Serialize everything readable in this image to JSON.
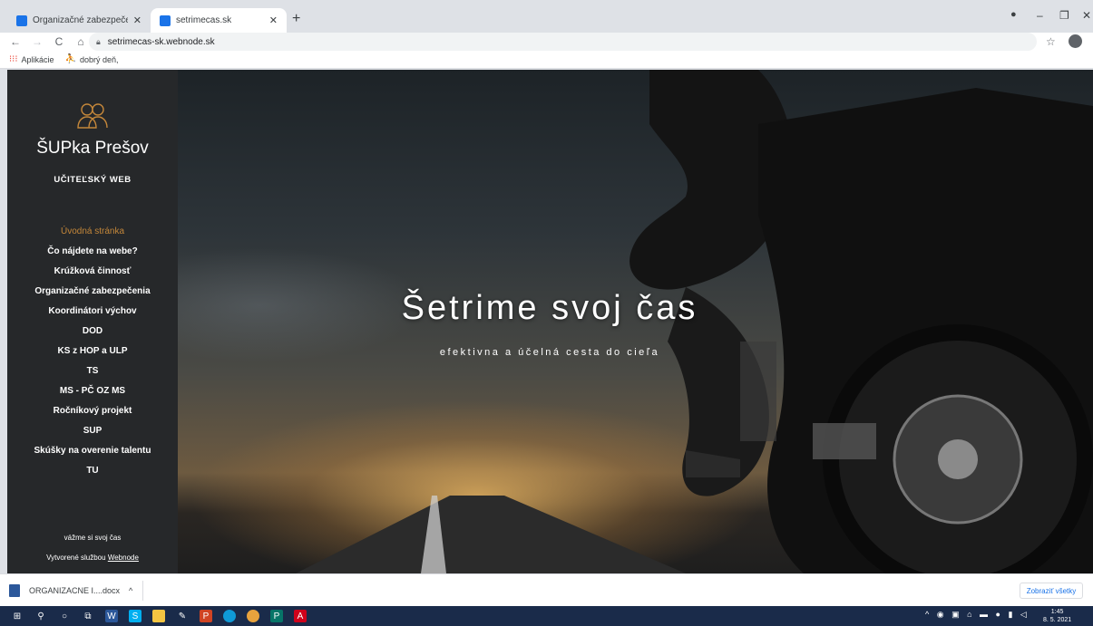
{
  "browser": {
    "tabs": [
      {
        "title": "Organizačné zabezpečenia :: setr",
        "active": false
      },
      {
        "title": "setrimecas.sk",
        "active": true
      }
    ],
    "url": "setrimecas-sk.webnode.sk",
    "bookmarks": [
      {
        "label": "Aplikácie",
        "icon": "apps-grid-icon"
      },
      {
        "label": "dobrý deň,",
        "icon": "bookmark-icon"
      }
    ]
  },
  "sidebar": {
    "title": "ŠUPka Prešov",
    "subtitle": "UČITEĽSKÝ WEB",
    "menu": [
      {
        "label": "Úvodná stránka",
        "active": true
      },
      {
        "label": "Čo nájdete na webe?"
      },
      {
        "label": "Krúžková činnosť"
      },
      {
        "label": "Organizačné zabezpečenia"
      },
      {
        "label": "Koordinátori výchov"
      },
      {
        "label": "DOD"
      },
      {
        "label": "KS z HOP a ULP"
      },
      {
        "label": "TS"
      },
      {
        "label": "MS - PČ OZ MS"
      },
      {
        "label": "Ročníkový projekt"
      },
      {
        "label": "SUP"
      },
      {
        "label": "Skúšky na overenie talentu"
      },
      {
        "label": "TU"
      }
    ],
    "footer_tagline": "vážme si svoj čas",
    "footer_created_prefix": "Vytvorené službou",
    "footer_created_link": "Webnode"
  },
  "hero": {
    "title": "Šetrime svoj čas",
    "subtitle": "efektivna a účelná cesta do cieľa"
  },
  "downloads": {
    "file": "ORGANIZACNE I....docx",
    "show_all": "Zobraziť všetky"
  },
  "taskbar": {
    "time": "1:45",
    "date": "8. 5. 2021"
  },
  "colors": {
    "sidebar_bg": "#26282a",
    "active_menu": "#c4873a"
  }
}
